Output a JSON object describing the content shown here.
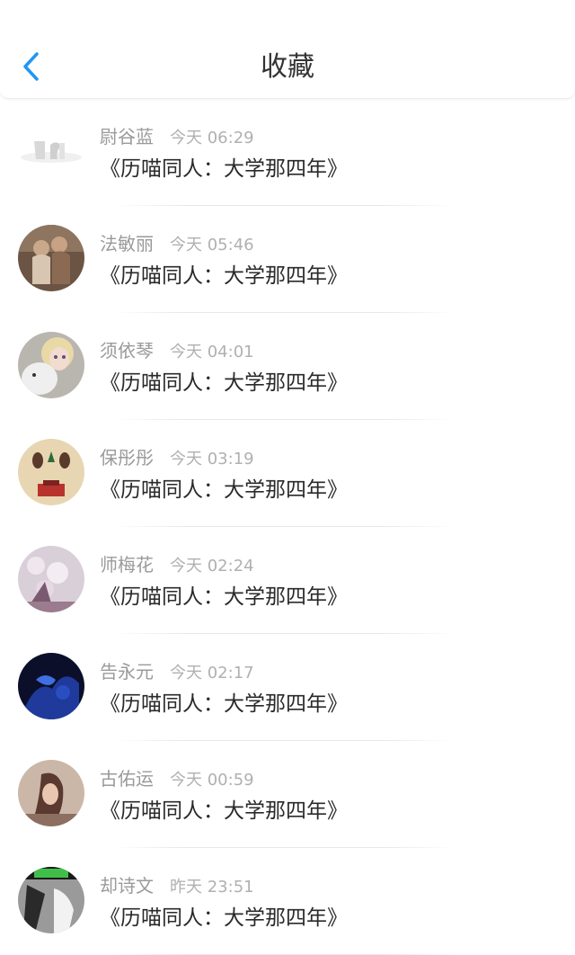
{
  "header": {
    "title": "收藏",
    "back_icon": "chevron-left-icon",
    "accent": "#2196F3"
  },
  "favorites": [
    {
      "name": "尉谷蓝",
      "time": "今天 06:29",
      "title": "《历喵同人：大学那四年》",
      "avatar": "logo-avatar"
    },
    {
      "name": "法敏丽",
      "time": "今天 05:46",
      "title": "《历喵同人：大学那四年》",
      "avatar": "children-photo-avatar"
    },
    {
      "name": "须依琴",
      "time": "今天 04:01",
      "title": "《历喵同人：大学那四年》",
      "avatar": "doll-avatar"
    },
    {
      "name": "保彤彤",
      "time": "今天 03:19",
      "title": "《历喵同人：大学那四年》",
      "avatar": "illustration-avatar"
    },
    {
      "name": "师梅花",
      "time": "今天 02:24",
      "title": "《历喵同人：大学那四年》",
      "avatar": "blossom-avatar"
    },
    {
      "name": "告永元",
      "time": "今天 02:17",
      "title": "《历喵同人：大学那四年》",
      "avatar": "dark-blue-avatar"
    },
    {
      "name": "古佑运",
      "time": "今天 00:59",
      "title": "《历喵同人：大学那四年》",
      "avatar": "portrait-avatar"
    },
    {
      "name": "却诗文",
      "time": "昨天 23:51",
      "title": "《历喵同人：大学那四年》",
      "avatar": "bw-photo-avatar"
    }
  ]
}
